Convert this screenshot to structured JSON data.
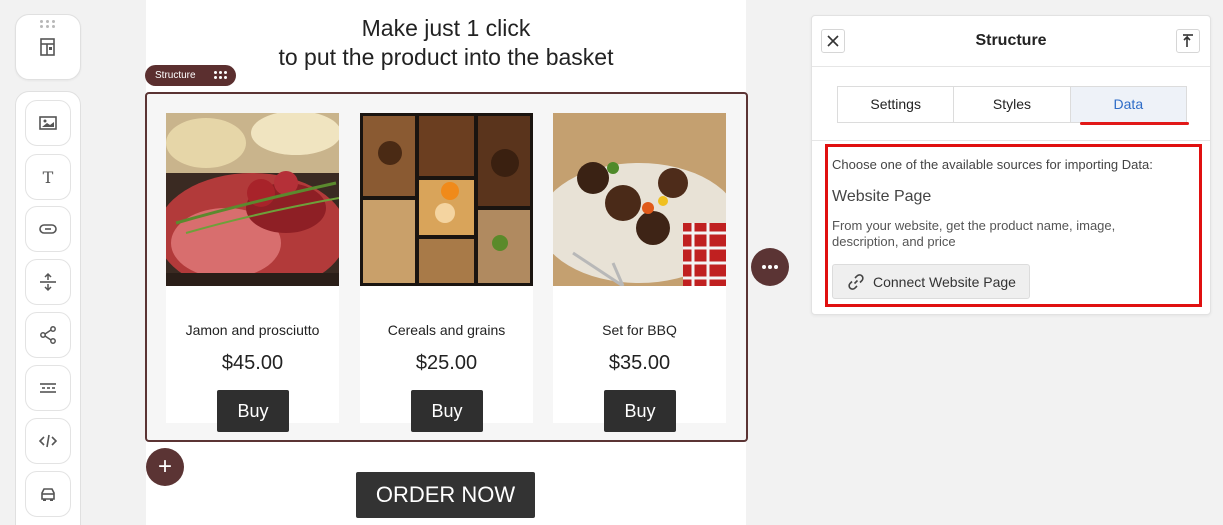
{
  "toolbar": {
    "top_icon": "layout-template-icon",
    "items": [
      {
        "icon": "image-icon"
      },
      {
        "icon": "text-icon"
      },
      {
        "icon": "button-icon"
      },
      {
        "icon": "spacer-icon"
      },
      {
        "icon": "share-icon"
      },
      {
        "icon": "divider-icon"
      },
      {
        "icon": "code-icon"
      },
      {
        "icon": "product-icon"
      }
    ]
  },
  "canvas": {
    "headline_line1": "Make just 1 click",
    "headline_line2": "to put the product into the basket",
    "structure_tag": "Structure",
    "products": [
      {
        "name": "Jamon and prosciutto",
        "price": "$45.00",
        "buy_label": "Buy"
      },
      {
        "name": "Cereals and grains",
        "price": "$25.00",
        "buy_label": "Buy"
      },
      {
        "name": "Set for BBQ",
        "price": "$35.00",
        "buy_label": "Buy"
      }
    ],
    "order_label": "ORDER NOW",
    "add_symbol": "+"
  },
  "panel": {
    "title": "Structure",
    "tabs": [
      {
        "label": "Settings",
        "active": false
      },
      {
        "label": "Styles",
        "active": false
      },
      {
        "label": "Data",
        "active": true
      }
    ],
    "data": {
      "intro": "Choose one of the available sources for importing Data:",
      "source_title": "Website Page",
      "source_desc": "From your website, get the product name, image, description, and price",
      "connect_label": "Connect Website Page"
    }
  },
  "colors": {
    "accent_brown": "#5b3434",
    "active_tab_text": "#2e6cc7",
    "highlight_red": "#e01010",
    "button_dark": "#2f2f2f"
  }
}
